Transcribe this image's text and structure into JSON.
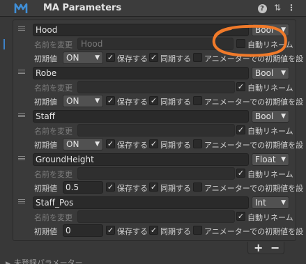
{
  "header": {
    "title": "MA Parameters",
    "help_glyph": "?",
    "settings_glyph": "⇅",
    "menu_glyph": "⋮"
  },
  "labels": {
    "rename": "名前を変更",
    "auto_rename": "自動リネーム",
    "initial": "初期値",
    "save": "保存する",
    "sync": "同期する",
    "anim_default": "アニメーターでの初期値を設"
  },
  "params": [
    {
      "name": "Hood",
      "type": "Bool",
      "rename_placeholder": "Hood",
      "auto_rename": false,
      "initial": "ON",
      "initial_kind": "select",
      "save": true,
      "sync": true,
      "anim_default": false
    },
    {
      "name": "Robe",
      "type": "Bool",
      "rename_placeholder": "",
      "auto_rename": true,
      "initial": "ON",
      "initial_kind": "select",
      "save": true,
      "sync": true,
      "anim_default": false
    },
    {
      "name": "Staff",
      "type": "Bool",
      "rename_placeholder": "",
      "auto_rename": true,
      "initial": "ON",
      "initial_kind": "select",
      "save": true,
      "sync": true,
      "anim_default": false
    },
    {
      "name": "GroundHeight",
      "type": "Float",
      "rename_placeholder": "",
      "auto_rename": true,
      "initial": "0.5",
      "initial_kind": "field",
      "save": true,
      "sync": true,
      "anim_default": false
    },
    {
      "name": "Staff_Pos",
      "type": "Int",
      "rename_placeholder": "",
      "auto_rename": true,
      "initial": "0",
      "initial_kind": "field",
      "save": true,
      "sync": true,
      "anim_default": false
    }
  ],
  "controls": {
    "add": "+",
    "remove": "−"
  },
  "foldout": {
    "label": "未登録パラメーター"
  },
  "colors": {
    "annotation": "#f07a2a",
    "accent": "#3d82c9"
  }
}
